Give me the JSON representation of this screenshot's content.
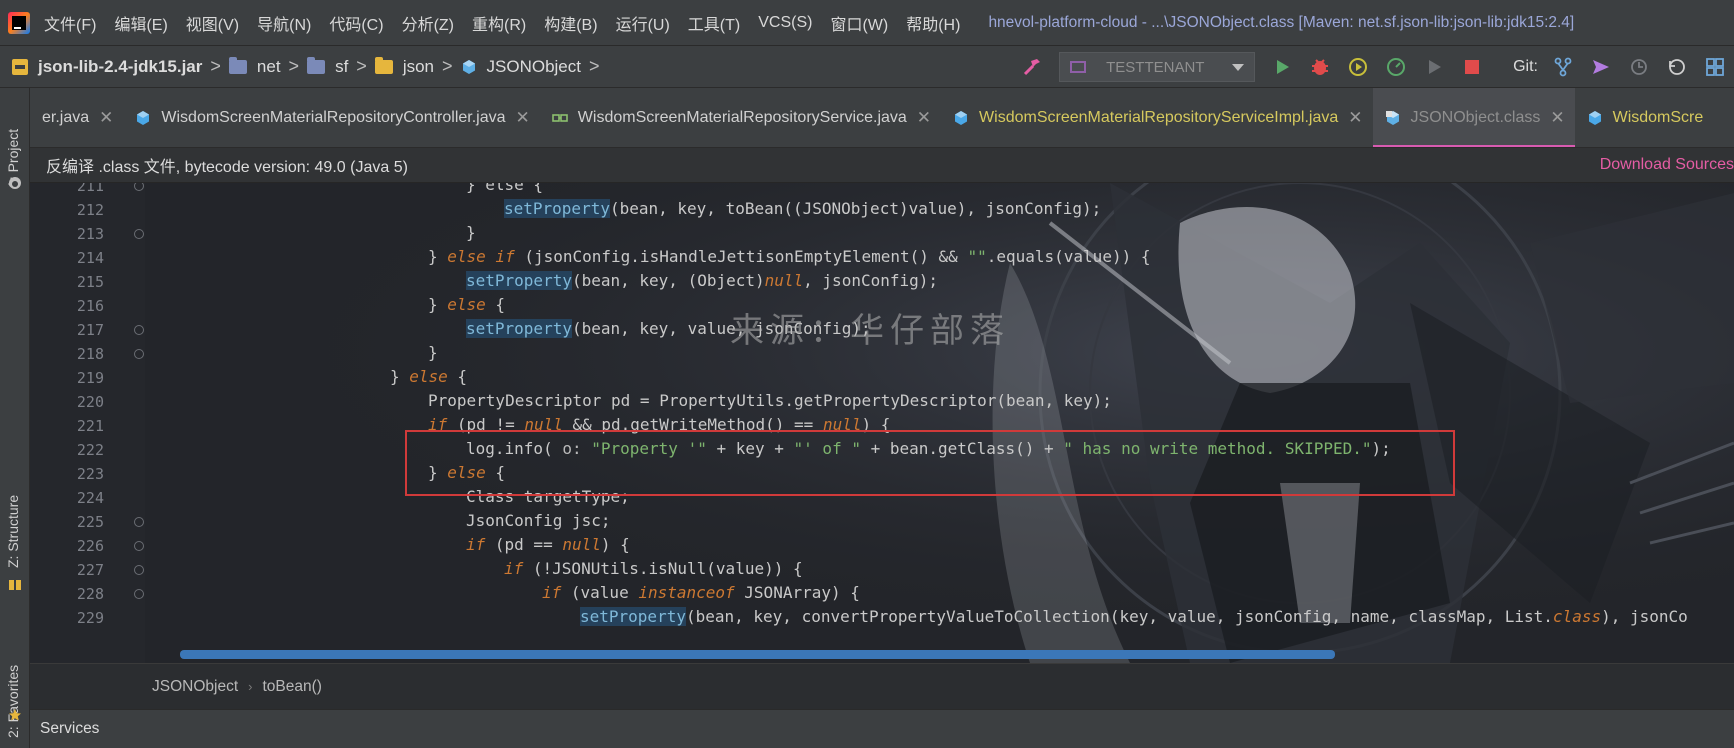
{
  "menu": {
    "items": [
      "文件(F)",
      "编辑(E)",
      "视图(V)",
      "导航(N)",
      "代码(C)",
      "分析(Z)",
      "重构(R)",
      "构建(B)",
      "运行(U)",
      "工具(T)",
      "VCS(S)",
      "窗口(W)",
      "帮助(H)"
    ],
    "window_title": "hnevol-platform-cloud - ...\\JSONObject.class [Maven: net.sf.json-lib:json-lib:jdk15:2.4]"
  },
  "navbar": {
    "jar": "json-lib-2.4-jdk15.jar",
    "crumbs": [
      "net",
      "sf",
      "json",
      "JSONObject"
    ],
    "run_config": "TESTTENANT",
    "git_label": "Git:"
  },
  "left_strip": {
    "project": "1: Project",
    "structure": "Z: Structure",
    "favorites": "2: Favorites"
  },
  "tabs": [
    {
      "label": "er.java",
      "kind": "java"
    },
    {
      "label": "WisdomScreenMaterialRepositoryController.java",
      "kind": "java"
    },
    {
      "label": "WisdomScreenMaterialRepositoryService.java",
      "kind": "interface"
    },
    {
      "label": "WisdomScreenMaterialRepositoryServiceImpl.java",
      "kind": "impl"
    },
    {
      "label": "JSONObject.class",
      "kind": "class-active"
    },
    {
      "label": "WisdomScre",
      "kind": "cut"
    }
  ],
  "banner": {
    "text": "反编译 .class 文件, bytecode version: 49.0 (Java 5)",
    "link": "Download Sources"
  },
  "editor": {
    "line_numbers": [
      "211",
      "212",
      "213",
      "214",
      "215",
      "216",
      "217",
      "218",
      "219",
      "220",
      "221",
      "222",
      "223",
      "224",
      "225",
      "226",
      "227",
      "228",
      "229"
    ],
    "watermark": "来源：华仔部落",
    "code": {
      "l211": "} else {",
      "l212_method": "setProperty",
      "l212_rest": "(bean, key, toBean((JSONObject)value), jsonConfig);",
      "l213": "}",
      "l214_close": "} ",
      "l214_kw1": "else if",
      "l214_rest1": " (jsonConfig.isHandleJettisonEmptyElement() && ",
      "l214_str": "\"\"",
      "l214_rest2": ".equals(value)) {",
      "l215_method": "setProperty",
      "l215_rest1": "(bean, key, (Object)",
      "l215_kw": "null",
      "l215_rest2": ", jsonConfig);",
      "l216_close": "} ",
      "l216_kw": "else",
      "l216_rest": " {",
      "l217_method": "setProperty",
      "l217_rest": "(bean, key, value, jsonConfig);",
      "l218": "}",
      "l219_close": "} ",
      "l219_kw": "else",
      "l219_rest": " {",
      "l220": "PropertyDescriptor pd = PropertyUtils.getPropertyDescriptor(bean, key);",
      "l221_kw1": "if",
      "l221_rest1": " (pd != ",
      "l221_kw2": "null",
      "l221_rest2": " && pd.getWriteMethod() == ",
      "l221_kw3": "null",
      "l221_rest3": ") {",
      "l222_pre": "log.info(",
      "l222_hint": " o: ",
      "l222_str1": "\"Property '\"",
      "l222_mid1": " + key + ",
      "l222_str2": "\"' of \"",
      "l222_mid2": " + bean.getClass() + ",
      "l222_str3": "\" has no write method. SKIPPED.\"",
      "l222_end": ");",
      "l223_close": "} ",
      "l223_kw": "else",
      "l223_rest": " {",
      "l224": "Class targetType;",
      "l225": "JsonConfig jsc;",
      "l226_kw1": "if",
      "l226_rest1": " (pd == ",
      "l226_kw2": "null",
      "l226_rest2": ") {",
      "l227_kw": "if",
      "l227_rest": " (!JSONUtils.isNull(value)) {",
      "l228_kw1": "if",
      "l228_rest1": " (value ",
      "l228_kw2": "instanceof",
      "l228_rest2": " JSONArray) {",
      "l229_method": "setProperty",
      "l229_rest": "(bean, key, convertPropertyValueToCollection(key, value, jsonConfig, name, classMap, List.",
      "l229_kw": "class",
      "l229_rest2": "), jsonCo"
    }
  },
  "editor_breadcrumb": [
    "JSONObject",
    "toBean()"
  ],
  "services": "Services",
  "colors": {
    "keyword": "#cc7832",
    "string": "#7eb46e",
    "method_highlight": "#7fb8d8",
    "highlight_box": "#d03a3a",
    "active_tab_underline": "#d85bb1",
    "link": "#e55da4"
  }
}
